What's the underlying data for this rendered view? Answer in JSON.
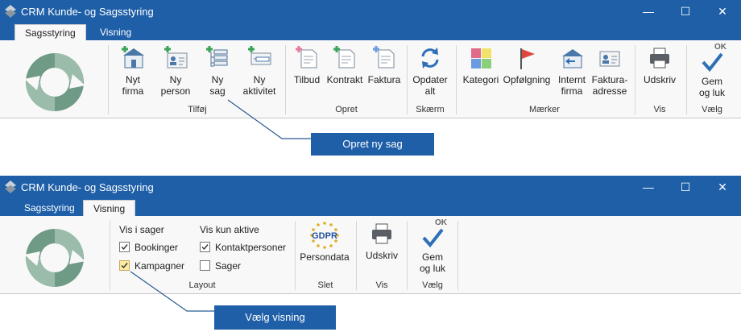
{
  "top_window": {
    "title": "CRM Kunde- og Sagsstyring",
    "tabs": [
      "Sagsstyring",
      "Visning"
    ],
    "groups": {
      "tilfoej": {
        "label": "Tilføj",
        "buttons": [
          {
            "line1": "Nyt",
            "line2": "firma"
          },
          {
            "line1": "Ny",
            "line2": "person"
          },
          {
            "line1": "Ny",
            "line2": "sag"
          },
          {
            "line1": "Ny",
            "line2": "aktivitet"
          }
        ]
      },
      "opret": {
        "label": "Opret",
        "buttons": [
          "Tilbud",
          "Kontrakt",
          "Faktura"
        ]
      },
      "skaerm": {
        "label": "Skærm",
        "button_line1": "Opdater",
        "button_line2": "alt"
      },
      "maerker": {
        "label": "Mærker",
        "buttons": [
          {
            "line1": "Kategori",
            "line2": ""
          },
          {
            "line1": "Opfølgning",
            "line2": ""
          },
          {
            "line1": "Internt",
            "line2": "firma"
          },
          {
            "line1": "Faktura-",
            "line2": "adresse"
          }
        ]
      },
      "vis": {
        "label": "Vis",
        "button": "Udskriv"
      },
      "vaelg": {
        "label": "Vælg",
        "button_line1": "Gem",
        "button_line2": "og luk",
        "ok_text": "OK"
      }
    },
    "callout": "Opret ny sag"
  },
  "bottom_window": {
    "title": "CRM Kunde- og Sagsstyring",
    "tabs": [
      "Sagsstyring",
      "Visning"
    ],
    "layout": {
      "label": "Layout",
      "vis_i_sager": "Vis i sager",
      "vis_kun_aktive": "Vis kun aktive",
      "checkboxes": [
        {
          "label": "Bookinger",
          "checked": true
        },
        {
          "label": "Kampagner",
          "checked": true
        },
        {
          "label": "Kontaktpersoner",
          "checked": true
        },
        {
          "label": "Sager",
          "checked": false
        }
      ]
    },
    "slet": {
      "label": "Slet",
      "button": "Persondata",
      "gdpr_text": "GDPR"
    },
    "vis": {
      "label": "Vis",
      "button": "Udskriv"
    },
    "vaelg": {
      "label": "Vælg",
      "button_line1": "Gem",
      "button_line2": "og luk",
      "ok_text": "OK"
    },
    "callout": "Vælg visning"
  },
  "window_controls": {
    "minimize": "—",
    "maximize": "☐",
    "close": "✕"
  },
  "colors": {
    "titlebar": "#1e5fa8",
    "callout": "#1f5fa8",
    "ribbon": "#f8f8f8"
  }
}
